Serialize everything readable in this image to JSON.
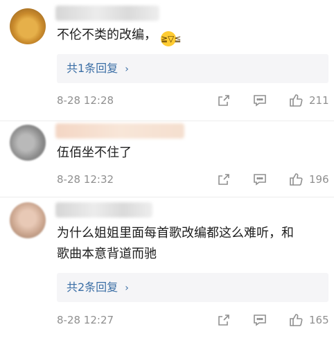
{
  "comments": [
    {
      "text": "不伦不类的改编，",
      "emoji_icon": "laughing-crying-emoji",
      "reply_label": "共1条回复",
      "time": "8-28 12:28",
      "likes": "211"
    },
    {
      "text": "伍佰坐不住了",
      "time": "8-28 12:32",
      "likes": "196"
    },
    {
      "text_line1": "为什么姐姐里面每首歌改编都这么难听，和",
      "text_line2": "歌曲本意背道而驰",
      "reply_label": "共2条回复",
      "time": "8-28 12:27",
      "likes": "165"
    }
  ],
  "colors": {
    "link": "#3a6ea5",
    "meta": "#8f8f8f",
    "text": "#1d1d1d",
    "reply_bg": "#f5f5f7"
  },
  "icons": {
    "share": "share-icon",
    "comment": "comment-icon",
    "like": "thumbs-up-icon",
    "chevron": "chevron-right-icon"
  }
}
